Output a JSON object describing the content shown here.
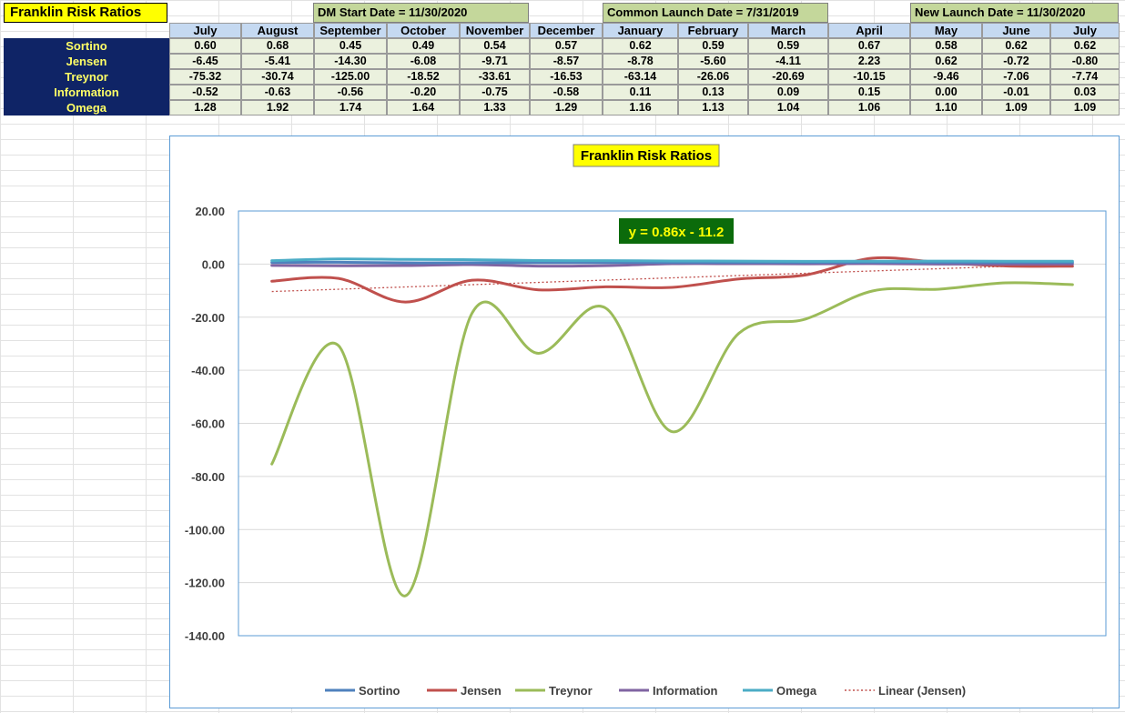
{
  "sheet": {
    "title": "Franklin Risk Ratios",
    "banners": [
      "DM Start Date = 11/30/2020",
      "Common Launch Date = 7/31/2019",
      "New Launch Date = 11/30/2020"
    ],
    "months": [
      "July",
      "August",
      "September",
      "October",
      "November",
      "December",
      "January",
      "February",
      "March",
      "April",
      "May",
      "June",
      "July"
    ],
    "rows": [
      {
        "label": "Sortino",
        "values": [
          "0.60",
          "0.68",
          "0.45",
          "0.49",
          "0.54",
          "0.57",
          "0.62",
          "0.59",
          "0.59",
          "0.67",
          "0.58",
          "0.62",
          "0.62"
        ]
      },
      {
        "label": "Jensen",
        "values": [
          "-6.45",
          "-5.41",
          "-14.30",
          "-6.08",
          "-9.71",
          "-8.57",
          "-8.78",
          "-5.60",
          "-4.11",
          "2.23",
          "0.62",
          "-0.72",
          "-0.80"
        ]
      },
      {
        "label": "Treynor",
        "values": [
          "-75.32",
          "-30.74",
          "-125.00",
          "-18.52",
          "-33.61",
          "-16.53",
          "-63.14",
          "-26.06",
          "-20.69",
          "-10.15",
          "-9.46",
          "-7.06",
          "-7.74"
        ]
      },
      {
        "label": "Information",
        "values": [
          "-0.52",
          "-0.63",
          "-0.56",
          "-0.20",
          "-0.75",
          "-0.58",
          "0.11",
          "0.13",
          "0.09",
          "0.15",
          "0.00",
          "-0.01",
          "0.03"
        ]
      },
      {
        "label": "Omega",
        "values": [
          "1.28",
          "1.92",
          "1.74",
          "1.64",
          "1.33",
          "1.29",
          "1.16",
          "1.13",
          "1.04",
          "1.06",
          "1.10",
          "1.09",
          "1.09"
        ]
      }
    ]
  },
  "chart_data": {
    "type": "line",
    "title": "Franklin Risk Ratios",
    "x": [
      "July",
      "August",
      "September",
      "October",
      "November",
      "December",
      "January",
      "February",
      "March",
      "April",
      "May",
      "June",
      "July"
    ],
    "ylim": [
      -140,
      20
    ],
    "yticks": [
      "20.00",
      "0.00",
      "-20.00",
      "-40.00",
      "-60.00",
      "-80.00",
      "-100.00",
      "-120.00",
      "-140.00"
    ],
    "grid": true,
    "legend_position": "bottom",
    "series": [
      {
        "name": "Sortino",
        "color": "#4f81bd",
        "values": [
          0.6,
          0.68,
          0.45,
          0.49,
          0.54,
          0.57,
          0.62,
          0.59,
          0.59,
          0.67,
          0.58,
          0.62,
          0.62
        ]
      },
      {
        "name": "Jensen",
        "color": "#c0504d",
        "values": [
          -6.45,
          -5.41,
          -14.3,
          -6.08,
          -9.71,
          -8.57,
          -8.78,
          -5.6,
          -4.11,
          2.23,
          0.62,
          -0.72,
          -0.8
        ]
      },
      {
        "name": "Treynor",
        "color": "#9bbb59",
        "values": [
          -75.32,
          -30.74,
          -125.0,
          -18.52,
          -33.61,
          -16.53,
          -63.14,
          -26.06,
          -20.69,
          -10.15,
          -9.46,
          -7.06,
          -7.74
        ]
      },
      {
        "name": "Information",
        "color": "#8064a2",
        "values": [
          -0.52,
          -0.63,
          -0.56,
          -0.2,
          -0.75,
          -0.58,
          0.11,
          0.13,
          0.09,
          0.15,
          0.0,
          -0.01,
          0.03
        ]
      },
      {
        "name": "Omega",
        "color": "#4bacc6",
        "values": [
          1.28,
          1.92,
          1.74,
          1.64,
          1.33,
          1.29,
          1.16,
          1.13,
          1.04,
          1.06,
          1.1,
          1.09,
          1.09
        ]
      }
    ],
    "trendline": {
      "name": "Linear (Jensen)",
      "color": "#c0504d",
      "slope": 0.86,
      "intercept": -11.2,
      "equation": "y = 0.86x - 11.2"
    }
  }
}
